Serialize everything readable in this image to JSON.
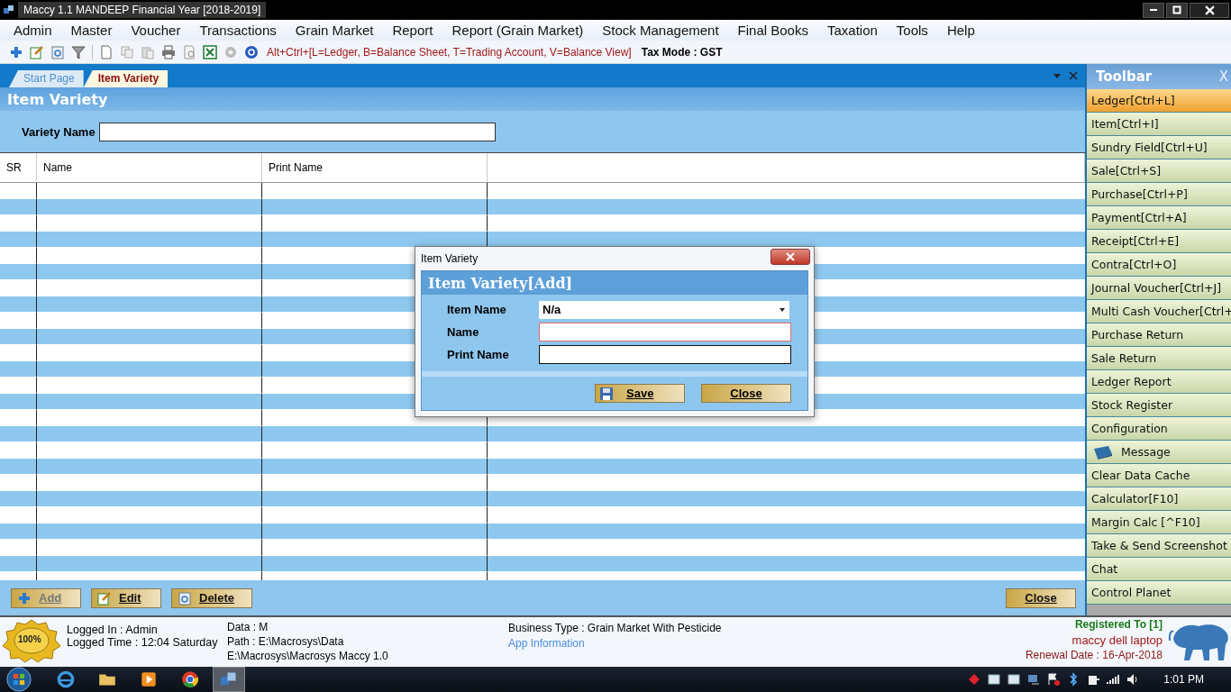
{
  "window": {
    "title": "Maccy 1.1 MANDEEP Financial Year [2018-2019]"
  },
  "menu": [
    "Admin",
    "Master",
    "Voucher",
    "Transactions",
    "Grain Market",
    "Report",
    "Report (Grain Market)",
    "Stock Management",
    "Final Books",
    "Taxation",
    "Tools",
    "Help"
  ],
  "toolbar": {
    "shortcut_hint": "Alt+Ctrl+[L=Ledger, B=Balance Sheet, T=Trading Account, V=Balance View]",
    "tax_mode": "Tax Mode : GST"
  },
  "tabs": [
    {
      "label": "Start Page",
      "selected": false
    },
    {
      "label": "Item Variety",
      "selected": true
    }
  ],
  "form": {
    "title": "Item Variety",
    "variety_label": "Variety Name"
  },
  "table": {
    "columns": [
      "SR",
      "Name",
      "Print Name"
    ]
  },
  "actions": [
    {
      "label": "Add",
      "disabled": true
    },
    {
      "label": "Edit",
      "disabled": false
    },
    {
      "label": "Delete",
      "disabled": false
    }
  ],
  "close_button": "Close",
  "dialog": {
    "window_title": "Item Variety",
    "heading": "Item Variety[Add]",
    "fields": [
      {
        "label": "Item Name",
        "kind": "dropdown",
        "value": "N/a",
        "invalid": false
      },
      {
        "label": "Name",
        "kind": "text",
        "invalid": true
      },
      {
        "label": "Print Name",
        "kind": "text",
        "invalid": false
      }
    ],
    "buttons": [
      "Save",
      "Close"
    ]
  },
  "side_toolbar": {
    "title": "Toolbar",
    "close": "X",
    "items": [
      {
        "label": "Ledger[Ctrl+L]",
        "selected": true,
        "kind": "text"
      },
      {
        "label": "Item[Ctrl+I]",
        "selected": false,
        "kind": "text"
      },
      {
        "label": "Sundry Field[Ctrl+U]",
        "selected": false,
        "kind": "text"
      },
      {
        "label": "Sale[Ctrl+S]",
        "selected": false,
        "kind": "text"
      },
      {
        "label": "Purchase[Ctrl+P]",
        "selected": false,
        "kind": "text"
      },
      {
        "label": "Payment[Ctrl+A]",
        "selected": false,
        "kind": "text"
      },
      {
        "label": "Receipt[Ctrl+E]",
        "selected": false,
        "kind": "text"
      },
      {
        "label": "Contra[Ctrl+O]",
        "selected": false,
        "kind": "text"
      },
      {
        "label": "Journal Voucher[Ctrl+J]",
        "selected": false,
        "kind": "text"
      },
      {
        "label": "Multi Cash Voucher[Ctrl+",
        "selected": false,
        "kind": "text"
      },
      {
        "label": "Purchase Return",
        "selected": false,
        "kind": "text"
      },
      {
        "label": "Sale Return",
        "selected": false,
        "kind": "text"
      },
      {
        "label": "Ledger Report",
        "selected": false,
        "kind": "text"
      },
      {
        "label": "Stock Register",
        "selected": false,
        "kind": "text"
      },
      {
        "label": "Configuration",
        "selected": false,
        "kind": "text"
      },
      {
        "label": "Message",
        "selected": false,
        "kind": "icon"
      },
      {
        "label": "Clear Data Cache",
        "selected": false,
        "kind": "text"
      },
      {
        "label": "Calculator[F10]",
        "selected": false,
        "kind": "text"
      },
      {
        "label": "Margin Calc [^F10]",
        "selected": false,
        "kind": "text"
      },
      {
        "label": "Take & Send Screenshot",
        "selected": false,
        "kind": "text"
      },
      {
        "label": "Chat",
        "selected": false,
        "kind": "text"
      },
      {
        "label": "Control Planet",
        "selected": false,
        "kind": "text"
      }
    ]
  },
  "status_bar": {
    "badge": "100%",
    "logged_in": "Logged In : Admin",
    "logged_time": "Logged Time : 12:04 Saturday",
    "data": "Data : M",
    "path": "Path : E:\\Macrosys\\Data",
    "install_path": "E:\\Macrosys\\Macrosys Maccy 1.0",
    "business_type": "Business Type : Grain Market With Pesticide",
    "app_info": "App Information",
    "registered": "Registered To [1]",
    "registered_name": "maccy dell laptop",
    "renewal": "Renewal Date : 16-Apr-2018"
  },
  "taskbar": {
    "clock": "1:01 PM"
  }
}
